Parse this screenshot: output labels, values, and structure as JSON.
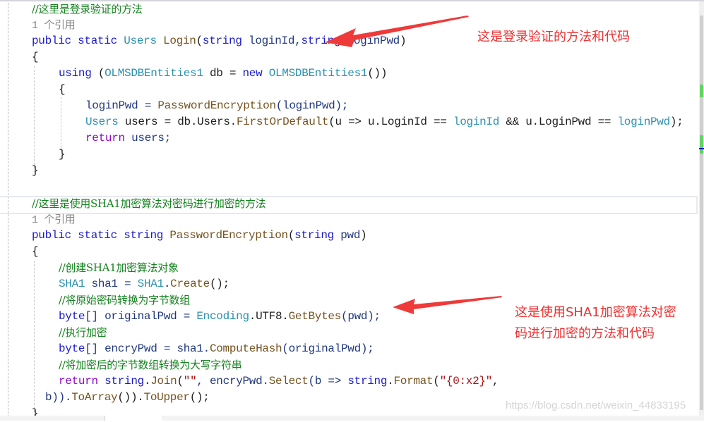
{
  "editor": {
    "section1": {
      "comment": "//这里是登录验证的方法",
      "codelens": "1 个引用",
      "signature": {
        "kw_public": "public",
        "kw_static": "static",
        "return_type": "Users",
        "method": "Login",
        "open": "(",
        "kw_string1": "string",
        "param1": " loginId,",
        "kw_string2": "string",
        "param2": " loginPwd",
        "close": ")"
      },
      "brace_open": "{",
      "using_line": {
        "kw_using": "using",
        "open": " (",
        "type": "OLMSDBEntities1",
        "rest": " db = ",
        "kw_new": "new",
        "type2": "OLMSDBEntities1",
        "close": "())"
      },
      "inner_brace_open": "{",
      "line_a": {
        "lhs": "loginPwd = ",
        "call": "PasswordEncryption",
        "args": "(loginPwd);"
      },
      "line_b": {
        "type": "Users",
        "mid": " users = db.Users.",
        "call": "FirstOrDefault",
        "args_start": "(u => u.LoginId == ",
        "param1": "loginId",
        "args_mid": " && u.LoginPwd == ",
        "param2": "loginPwd",
        "args_end": ");"
      },
      "line_c": {
        "kw_return": "return",
        "rest": " users;"
      },
      "inner_brace_close": "}",
      "brace_close": "}"
    },
    "section2": {
      "comment": "//这里是使用SHA1加密算法对密码进行加密的方法",
      "codelens": "1 个引用",
      "signature": {
        "kw_public": "public",
        "kw_static": "static",
        "kw_string": "string",
        "method": "PasswordEncryption",
        "open": "(",
        "kw_string2": "string",
        "param": " pwd",
        "close": ")"
      },
      "brace_open": "{",
      "c1": "//创建SHA1加密算法对象",
      "l1": {
        "type": "SHA1",
        "mid": " sha1 = ",
        "type2": "SHA1",
        "dot": ".",
        "call": "Create",
        "end": "();"
      },
      "c2": "//将原始密码转换为字节数组",
      "l2": {
        "kw": "byte",
        "mid": "[] originalPwd = ",
        "type": "Encoding",
        "mid2": ".UTF8.",
        "call": "GetBytes",
        "end": "(pwd);"
      },
      "c3": "//执行加密",
      "l3": {
        "kw": "byte",
        "mid": "[] encryPwd = sha1.",
        "call": "ComputeHash",
        "end": "(originalPwd);"
      },
      "c4": "//将加密后的字节数组转换为大写字符串",
      "l4": {
        "kw_return": "return",
        "kw_string": "string",
        "dot": ".",
        "call": "Join",
        "open": "(",
        "str1": "\"\"",
        "mid": ", encryPwd.",
        "call2": "Select",
        "lambda": "(b => ",
        "kw_string2": "string",
        "dot2": ".",
        "call3": "Format",
        "open2": "(",
        "str2": "\"{0:x2}\"",
        "comma": ","
      },
      "l5": {
        "start": "b)).",
        "call": "ToArray",
        "mid": "()).",
        "call2": "ToUpper",
        "end": "();"
      },
      "brace_close": "}"
    }
  },
  "annotations": {
    "note1": "这是登录验证的方法和代码",
    "note2_line1": "这是使用SHA1加密算法对密",
    "note2_line2": "码进行加密的方法和代码",
    "color": "#ef2f2f"
  },
  "watermark": "https://blog.csdn.net/weixin_44833195"
}
